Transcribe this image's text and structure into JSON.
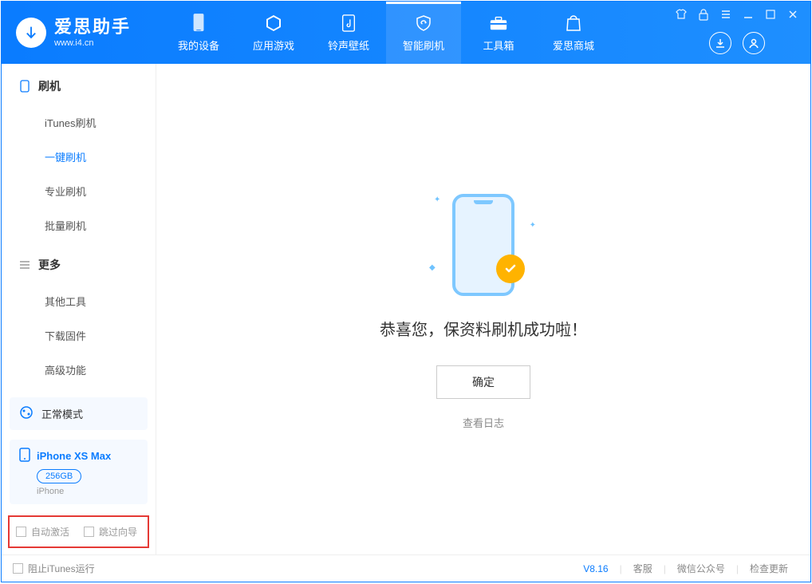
{
  "app": {
    "name": "爱思助手",
    "url": "www.i4.cn"
  },
  "nav": {
    "tabs": [
      {
        "label": "我的设备"
      },
      {
        "label": "应用游戏"
      },
      {
        "label": "铃声壁纸"
      },
      {
        "label": "智能刷机"
      },
      {
        "label": "工具箱"
      },
      {
        "label": "爱思商城"
      }
    ]
  },
  "sidebar": {
    "sections": [
      {
        "title": "刷机",
        "items": [
          {
            "label": "iTunes刷机"
          },
          {
            "label": "一键刷机"
          },
          {
            "label": "专业刷机"
          },
          {
            "label": "批量刷机"
          }
        ]
      },
      {
        "title": "更多",
        "items": [
          {
            "label": "其他工具"
          },
          {
            "label": "下载固件"
          },
          {
            "label": "高级功能"
          }
        ]
      }
    ],
    "mode": {
      "label": "正常模式"
    },
    "device": {
      "name": "iPhone XS Max",
      "capacity": "256GB",
      "type": "iPhone"
    },
    "options": {
      "auto_activate": "自动激活",
      "skip_guide": "跳过向导"
    }
  },
  "main": {
    "success_message": "恭喜您，保资料刷机成功啦！",
    "confirm_button": "确定",
    "view_log": "查看日志"
  },
  "footer": {
    "block_itunes": "阻止iTunes运行",
    "version": "V8.16",
    "links": [
      {
        "label": "客服"
      },
      {
        "label": "微信公众号"
      },
      {
        "label": "检查更新"
      }
    ]
  }
}
